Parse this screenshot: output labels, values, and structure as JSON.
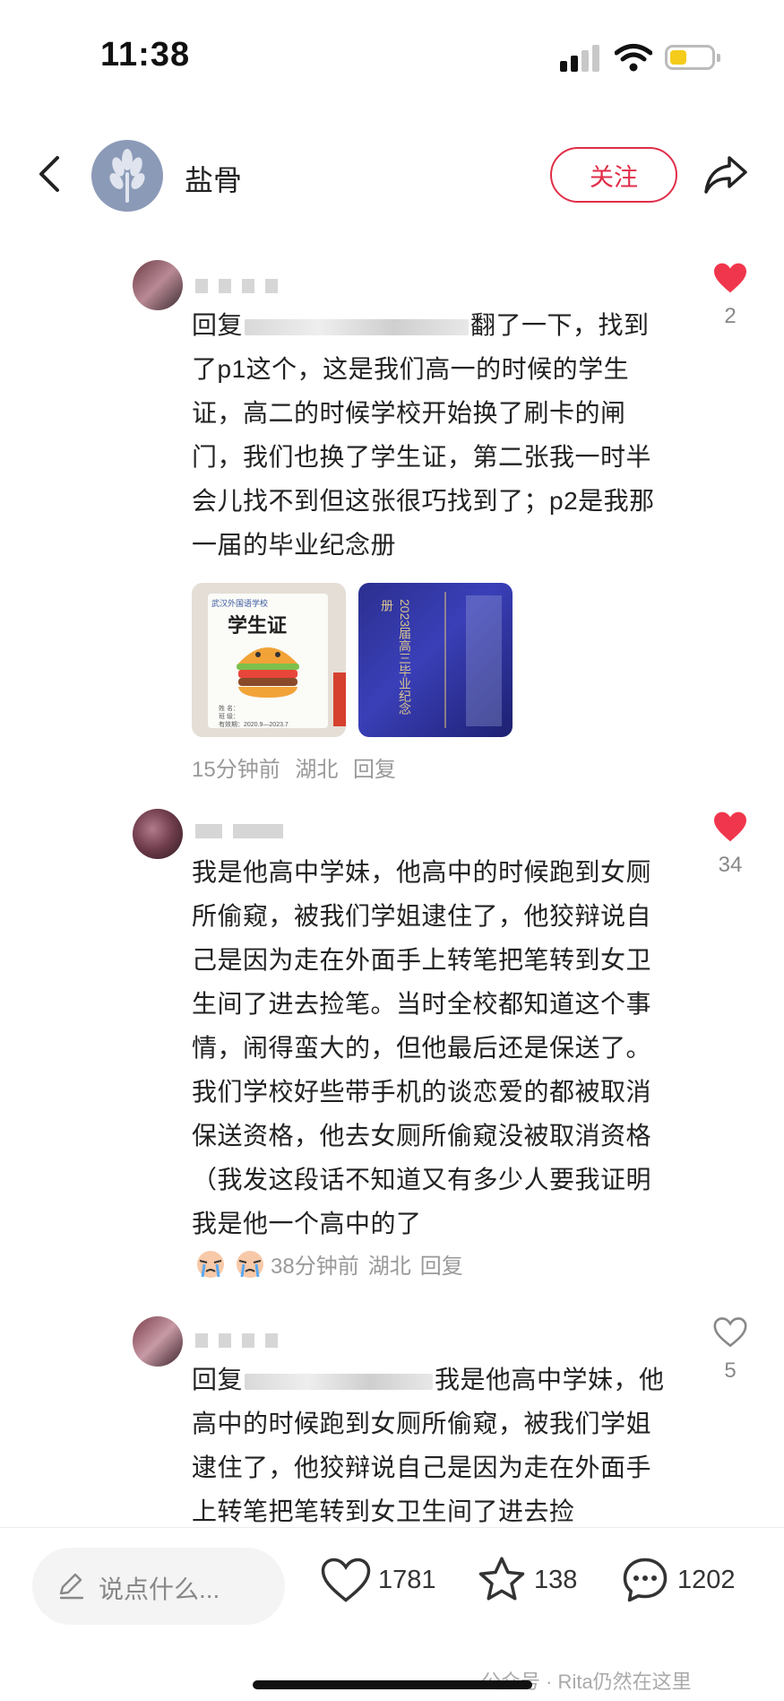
{
  "status": {
    "time": "11:38"
  },
  "header": {
    "author_name": "盐骨",
    "follow_label": "关注"
  },
  "comments": [
    {
      "text_prefix": "回复",
      "text_body": "翻了一下，找到了p1这个，这是我们高一的时候的学生证，高二的时候学校开始换了刷卡的闸门，我们也换了学生证，第二张我一时半会儿找不到但这张很巧找到了；p2是我那一届的毕业纪念册",
      "images": [
        {
          "title": "学生证",
          "school": "武汉外国语学校",
          "fields": [
            "姓  名：",
            "班  级：",
            "有效期：2020.9—2023.7"
          ]
        },
        {
          "title": "2023届高三毕业纪念册"
        }
      ],
      "time": "15分钟前",
      "location": "湖北",
      "reply": "回复",
      "likes": "2",
      "liked": true
    },
    {
      "text_body": "我是他高中学妹，他高中的时候跑到女厕所偷窥，被我们学姐逮住了，他狡辩说自己是因为走在外面手上转笔把笔转到女卫生间了进去捡笔。当时全校都知道这个事情，闹得蛮大的，但他最后还是保送了。我们学校好些带手机的谈恋爱的都被取消保送资格，他去女厕所偷窥没被取消资格（我发这段话不知道又有多少人要我证明我是他一个高中的了",
      "time": "38分钟前",
      "location": "湖北",
      "reply": "回复",
      "likes": "34",
      "liked": true
    },
    {
      "text_prefix": "回复",
      "text_body": "我是他高中学妹，他高中的时候跑到女厕所偷窥，被我们学姐逮住了，他狡辩说自己是因为走在外面手上转笔把笔转到女卫生间了进去捡",
      "likes": "5",
      "liked": false
    }
  ],
  "bottom": {
    "placeholder": "说点什么...",
    "likes": "1781",
    "stars": "138",
    "comments": "1202",
    "watermark": "公众号 · Rita仍然在这里"
  },
  "colors": {
    "accent": "#e02e48",
    "like": "#f0364c"
  }
}
